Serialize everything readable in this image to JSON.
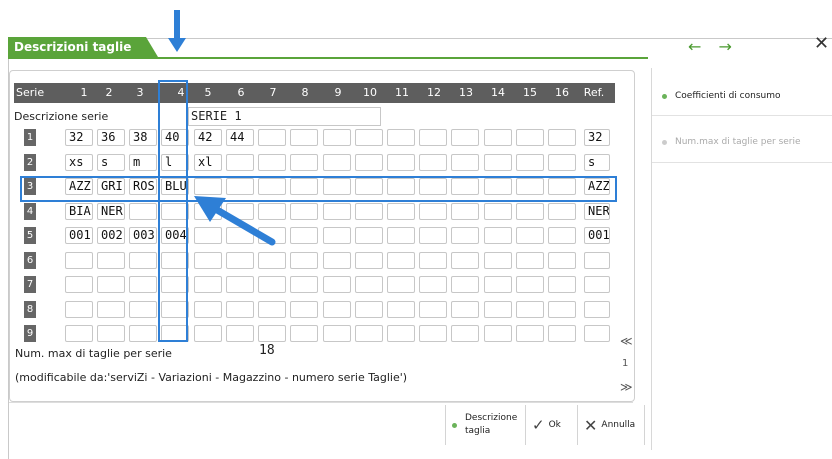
{
  "window": {
    "tab_title": "Descrizioni taglie",
    "nav_arrows": "← →",
    "close": "✕"
  },
  "right_panel": {
    "items": [
      {
        "label": "Coefficienti di consumo",
        "enabled": true
      },
      {
        "label": "Num.max di taglie per serie",
        "enabled": false
      }
    ]
  },
  "grid": {
    "header": [
      "Serie",
      "1",
      "2",
      "3",
      "4",
      "5",
      "6",
      "7",
      "8",
      "9",
      "10",
      "11",
      "12",
      "13",
      "14",
      "15",
      "16",
      "Ref."
    ],
    "descrizione_serie_label": "Descrizione serie",
    "descrizione_serie_value": "SERIE 1",
    "rows": [
      {
        "num": "1",
        "cells": [
          "32",
          "36",
          "38",
          "40",
          "42",
          "44",
          "",
          "",
          "",
          "",
          "",
          "",
          "",
          "",
          "",
          ""
        ],
        "ref": "32"
      },
      {
        "num": "2",
        "cells": [
          "xs",
          "s",
          "m",
          "l",
          "xl",
          "",
          "",
          "",
          "",
          "",
          "",
          "",
          "",
          "",
          "",
          ""
        ],
        "ref": "s"
      },
      {
        "num": "3",
        "cells": [
          "AZZ",
          "GRI",
          "ROS",
          "BLU",
          "",
          "",
          "",
          "",
          "",
          "",
          "",
          "",
          "",
          "",
          "",
          ""
        ],
        "ref": "AZZ"
      },
      {
        "num": "4",
        "cells": [
          "BIA",
          "NER",
          "",
          "",
          "",
          "",
          "",
          "",
          "",
          "",
          "",
          "",
          "",
          "",
          "",
          ""
        ],
        "ref": "NER"
      },
      {
        "num": "5",
        "cells": [
          "001",
          "002",
          "003",
          "004",
          "",
          "",
          "",
          "",
          "",
          "",
          "",
          "",
          "",
          "",
          "",
          ""
        ],
        "ref": "001"
      },
      {
        "num": "6",
        "cells": [
          "",
          "",
          "",
          "",
          "",
          "",
          "",
          "",
          "",
          "",
          "",
          "",
          "",
          "",
          "",
          ""
        ],
        "ref": ""
      },
      {
        "num": "7",
        "cells": [
          "",
          "",
          "",
          "",
          "",
          "",
          "",
          "",
          "",
          "",
          "",
          "",
          "",
          "",
          "",
          ""
        ],
        "ref": ""
      },
      {
        "num": "8",
        "cells": [
          "",
          "",
          "",
          "",
          "",
          "",
          "",
          "",
          "",
          "",
          "",
          "",
          "",
          "",
          "",
          ""
        ],
        "ref": ""
      },
      {
        "num": "9",
        "cells": [
          "",
          "",
          "",
          "",
          "",
          "",
          "",
          "",
          "",
          "",
          "",
          "",
          "",
          "",
          "",
          ""
        ],
        "ref": ""
      }
    ],
    "num_max_label": "Num. max di taglie per serie",
    "num_max_value": "18",
    "note": "(modificabile da:'serviZi - Variazioni - Magazzino - numero serie Taglie')"
  },
  "scroll": {
    "up": "≪",
    "page": "1",
    "down": "≫"
  },
  "buttons": {
    "descrizione_taglia_line1": "Descrizione",
    "descrizione_taglia_line2": "taglia",
    "ok": "Ok",
    "annulla": "Annulla"
  },
  "colors": {
    "accent_green": "#5aa43a",
    "annotation_blue": "#2e7fd6",
    "header_gray": "#5e5e5e"
  }
}
